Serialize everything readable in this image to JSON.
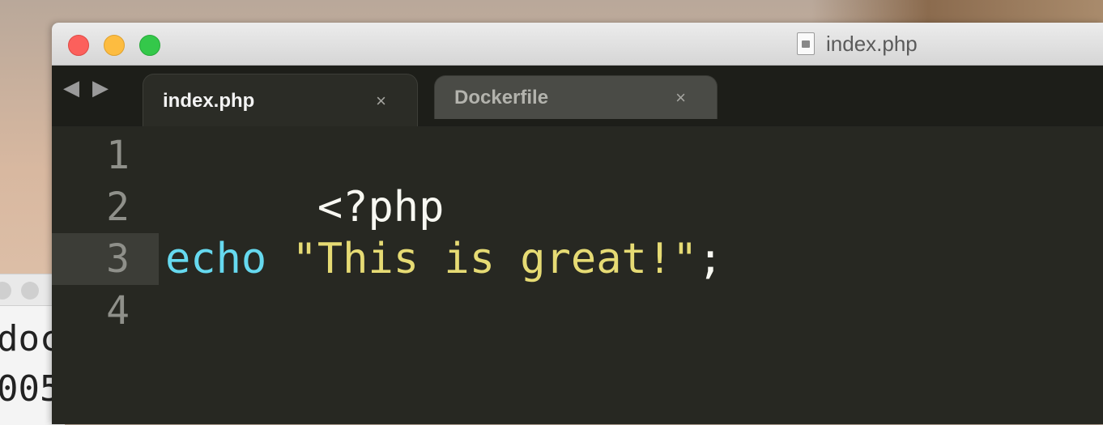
{
  "background_window": {
    "lines": [
      "doc",
      "005"
    ]
  },
  "window": {
    "title": "index.php"
  },
  "tabs": [
    {
      "label": "index.php",
      "close": "×",
      "active": true
    },
    {
      "label": "Dockerfile",
      "close": "×",
      "active": false
    }
  ],
  "nav": {
    "back": "◀",
    "forward": "▶"
  },
  "editor": {
    "current_line": 3,
    "lines": [
      {
        "number": "1",
        "tokens": [
          {
            "text": "<?php",
            "type": "php"
          }
        ]
      },
      {
        "number": "2",
        "tokens": []
      },
      {
        "number": "3",
        "tokens": [
          {
            "text": "echo",
            "type": "keyword"
          },
          {
            "text": " ",
            "type": "punct"
          },
          {
            "text": "\"This is great!\"",
            "type": "string"
          },
          {
            "text": ";",
            "type": "punct"
          }
        ]
      },
      {
        "number": "4",
        "tokens": []
      }
    ]
  },
  "colors": {
    "editor_bg": "#272822",
    "keyword": "#66d9ef",
    "string": "#e6db74",
    "default": "#f8f8f2",
    "gutter_text": "#8f908a"
  }
}
